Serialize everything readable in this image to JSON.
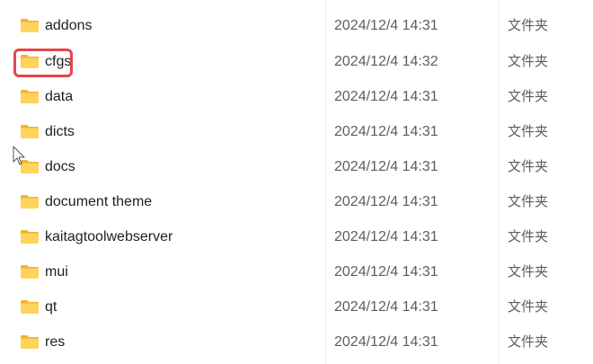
{
  "colors": {
    "folder_body": "#FFD35C",
    "folder_back": "#F2B12E",
    "highlight": "#E2474F",
    "date_text": "#5D5D5D"
  },
  "highlighted_item": "cfgs",
  "files": [
    {
      "name": "addons",
      "modified": "2024/12/4 14:31",
      "type": "文件夹",
      "icon": "folder-icon"
    },
    {
      "name": "cfgs",
      "modified": "2024/12/4 14:32",
      "type": "文件夹",
      "icon": "folder-icon"
    },
    {
      "name": "data",
      "modified": "2024/12/4 14:31",
      "type": "文件夹",
      "icon": "folder-icon"
    },
    {
      "name": "dicts",
      "modified": "2024/12/4 14:31",
      "type": "文件夹",
      "icon": "folder-icon"
    },
    {
      "name": "docs",
      "modified": "2024/12/4 14:31",
      "type": "文件夹",
      "icon": "folder-icon"
    },
    {
      "name": "document theme",
      "modified": "2024/12/4 14:31",
      "type": "文件夹",
      "icon": "folder-icon"
    },
    {
      "name": "kaitagtoolwebserver",
      "modified": "2024/12/4 14:31",
      "type": "文件夹",
      "icon": "folder-icon"
    },
    {
      "name": "mui",
      "modified": "2024/12/4 14:31",
      "type": "文件夹",
      "icon": "folder-icon"
    },
    {
      "name": "qt",
      "modified": "2024/12/4 14:31",
      "type": "文件夹",
      "icon": "folder-icon"
    },
    {
      "name": "res",
      "modified": "2024/12/4 14:31",
      "type": "文件夹",
      "icon": "folder-icon"
    }
  ]
}
